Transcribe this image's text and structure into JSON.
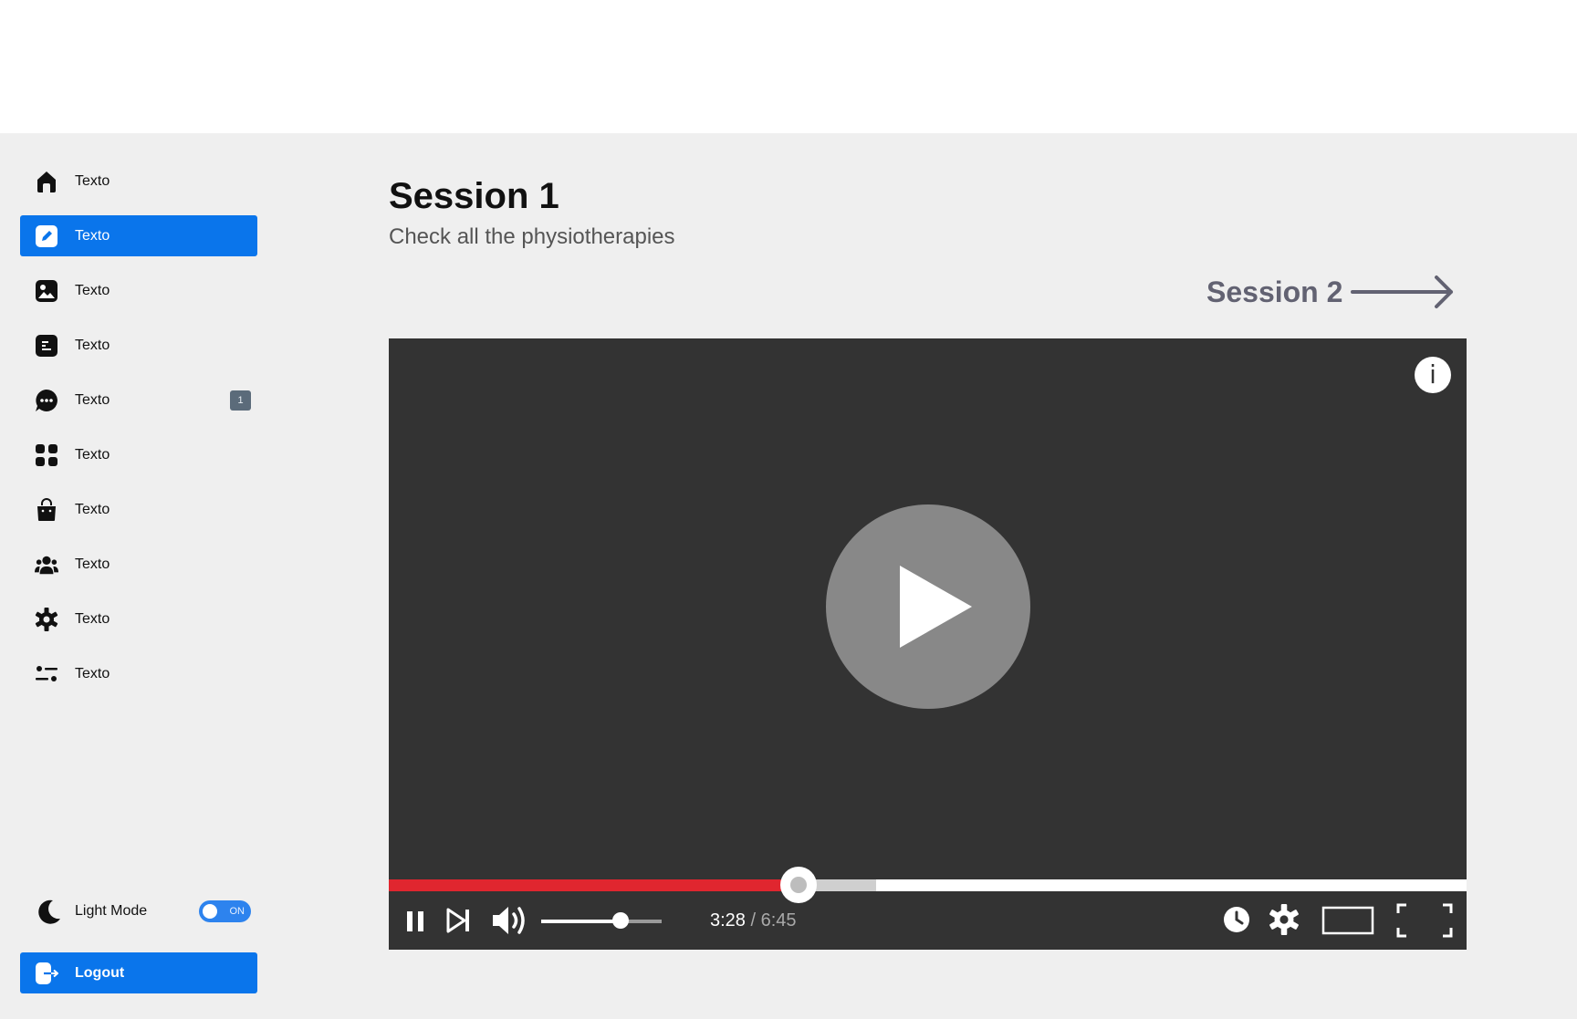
{
  "sidebar": {
    "items": [
      {
        "label": "Texto",
        "icon": "home-icon"
      },
      {
        "label": "Texto",
        "icon": "edit-icon",
        "active": true
      },
      {
        "label": "Texto",
        "icon": "image-icon"
      },
      {
        "label": "Texto",
        "icon": "document-icon"
      },
      {
        "label": "Texto",
        "icon": "chat-icon",
        "badge": "1"
      },
      {
        "label": "Texto",
        "icon": "grid-icon"
      },
      {
        "label": "Texto",
        "icon": "shopping-bag-icon"
      },
      {
        "label": "Texto",
        "icon": "users-icon"
      },
      {
        "label": "Texto",
        "icon": "gear-icon"
      },
      {
        "label": "Texto",
        "icon": "sliders-icon"
      }
    ],
    "mode": {
      "label": "Light Mode",
      "toggle_text": "ON",
      "icon": "moon-icon",
      "enabled": true
    },
    "logout": {
      "label": "Logout",
      "icon": "logout-icon"
    }
  },
  "main": {
    "title": "Session 1",
    "subtitle": "Check all the physiotherapies",
    "next_link": "Session 2"
  },
  "player": {
    "current_time": "3:28",
    "separator": " / ",
    "duration": "6:45",
    "progress_fraction": 0.38,
    "buffered_fraction": 0.452,
    "volume_fraction": 0.66,
    "colors": {
      "played": "#e0262f",
      "background": "#333333",
      "accent": "#0a75eb"
    },
    "icons": [
      "info-icon",
      "play-icon",
      "pause-icon",
      "skip-next-icon",
      "volume-icon",
      "clock-icon",
      "settings-icon",
      "theater-mode-icon",
      "fullscreen-icon"
    ]
  }
}
